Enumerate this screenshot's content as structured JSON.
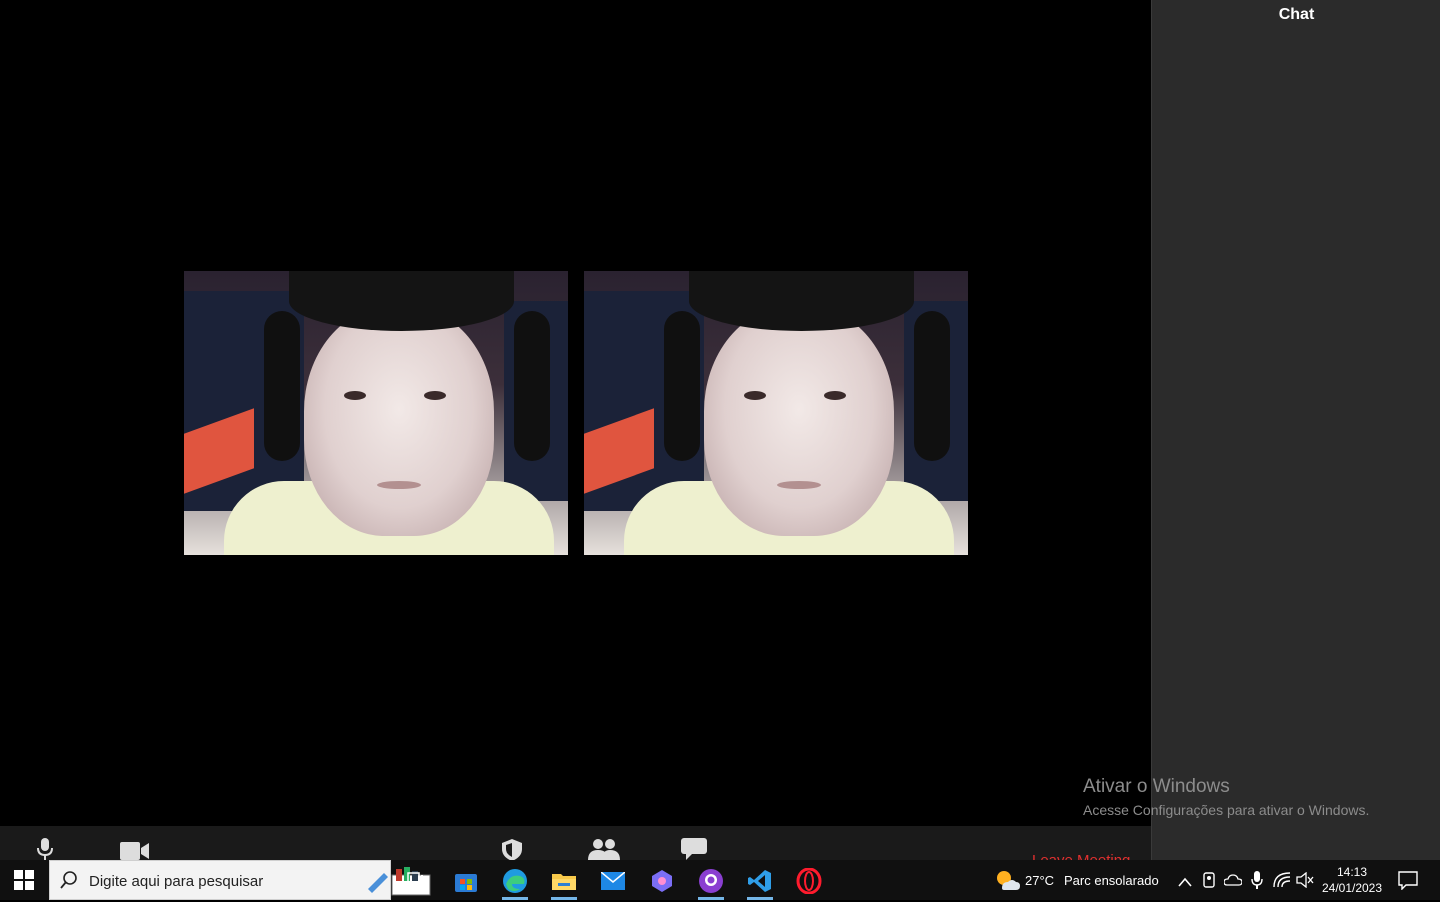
{
  "chat": {
    "title": "Chat"
  },
  "watermark": {
    "title": "Ativar o Windows",
    "subtitle": "Acesse Configurações para ativar o Windows."
  },
  "toolbar": {
    "items": [
      "microphone-icon",
      "camera-icon",
      "shield-icon",
      "participants-icon",
      "chat-bubble-icon"
    ],
    "leave_label": "Leave Meeting",
    "leave_color": "#e0302f"
  },
  "taskbar": {
    "search_placeholder": "Digite aqui para pesquisar",
    "weather_temp": "27°C",
    "weather_desc": "Parc ensolarado",
    "time": "14:13",
    "date": "24/01/2023",
    "accent": "#75b6e7"
  }
}
